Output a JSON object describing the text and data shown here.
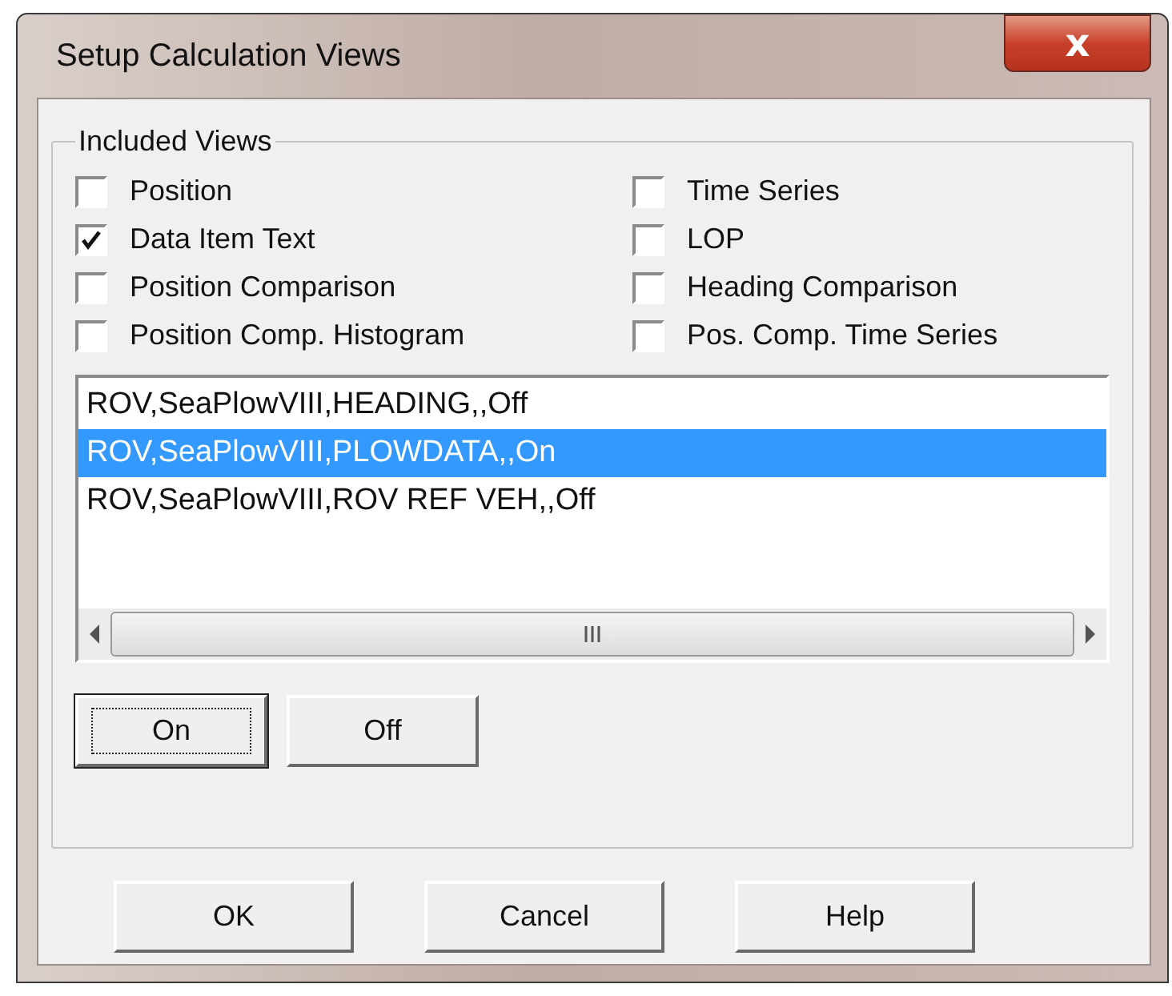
{
  "window": {
    "title": "Setup Calculation Views",
    "close": "x"
  },
  "group": {
    "label": "Included Views",
    "checkboxes": [
      {
        "label": "Position",
        "checked": false
      },
      {
        "label": "Time Series",
        "checked": false
      },
      {
        "label": "Data Item Text",
        "checked": true
      },
      {
        "label": "LOP",
        "checked": false
      },
      {
        "label": "Position Comparison",
        "checked": false
      },
      {
        "label": "Heading Comparison",
        "checked": false
      },
      {
        "label": "Position Comp. Histogram",
        "checked": false
      },
      {
        "label": "Pos. Comp. Time Series",
        "checked": false
      }
    ],
    "list": [
      {
        "text": "ROV,SeaPlowVIII,HEADING,,Off",
        "selected": false
      },
      {
        "text": "ROV,SeaPlowVIII,PLOWDATA,,On",
        "selected": true
      },
      {
        "text": "ROV,SeaPlowVIII,ROV REF VEH,,Off",
        "selected": false
      }
    ],
    "buttons": [
      {
        "label": "On",
        "focused": true
      },
      {
        "label": "Off",
        "focused": false
      }
    ]
  },
  "buttons": [
    "OK",
    "Cancel",
    "Help"
  ]
}
